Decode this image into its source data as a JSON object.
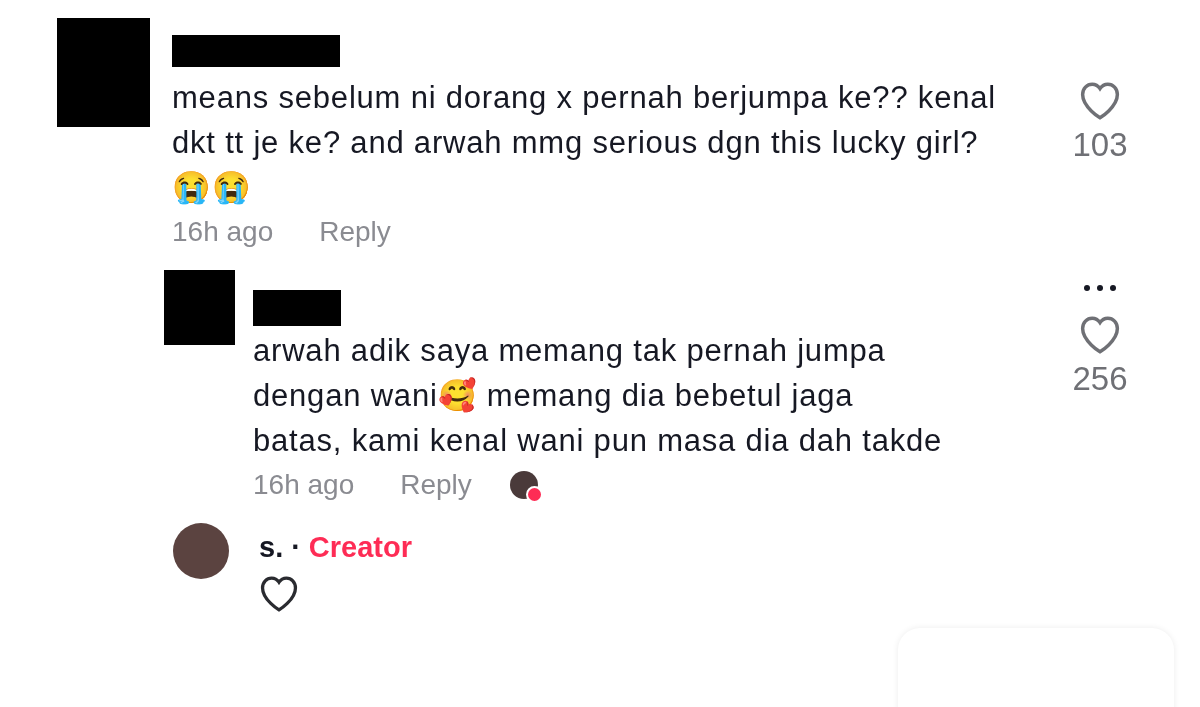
{
  "comments": [
    {
      "kind": "top",
      "text": "means sebelum ni dorang x pernah berjumpa ke?? kenal dkt tt je ke? and arwah mmg serious dgn this lucky girl? 😭😭",
      "time": "16h ago",
      "reply_label": "Reply",
      "likes": "103",
      "liked": false,
      "more_menu": false,
      "liked_by_creator": false
    },
    {
      "kind": "reply",
      "text": "arwah adik saya memang tak pernah jumpa dengan wani🥰 memang dia bebetul jaga batas, kami kenal wani pun masa dia dah takde",
      "time": "16h ago",
      "reply_label": "Reply",
      "likes": "256",
      "liked": false,
      "more_menu": true,
      "liked_by_creator": true
    }
  ],
  "creator_reply": {
    "name": "s.",
    "separator": "·",
    "badge": "Creator",
    "liked": false
  }
}
